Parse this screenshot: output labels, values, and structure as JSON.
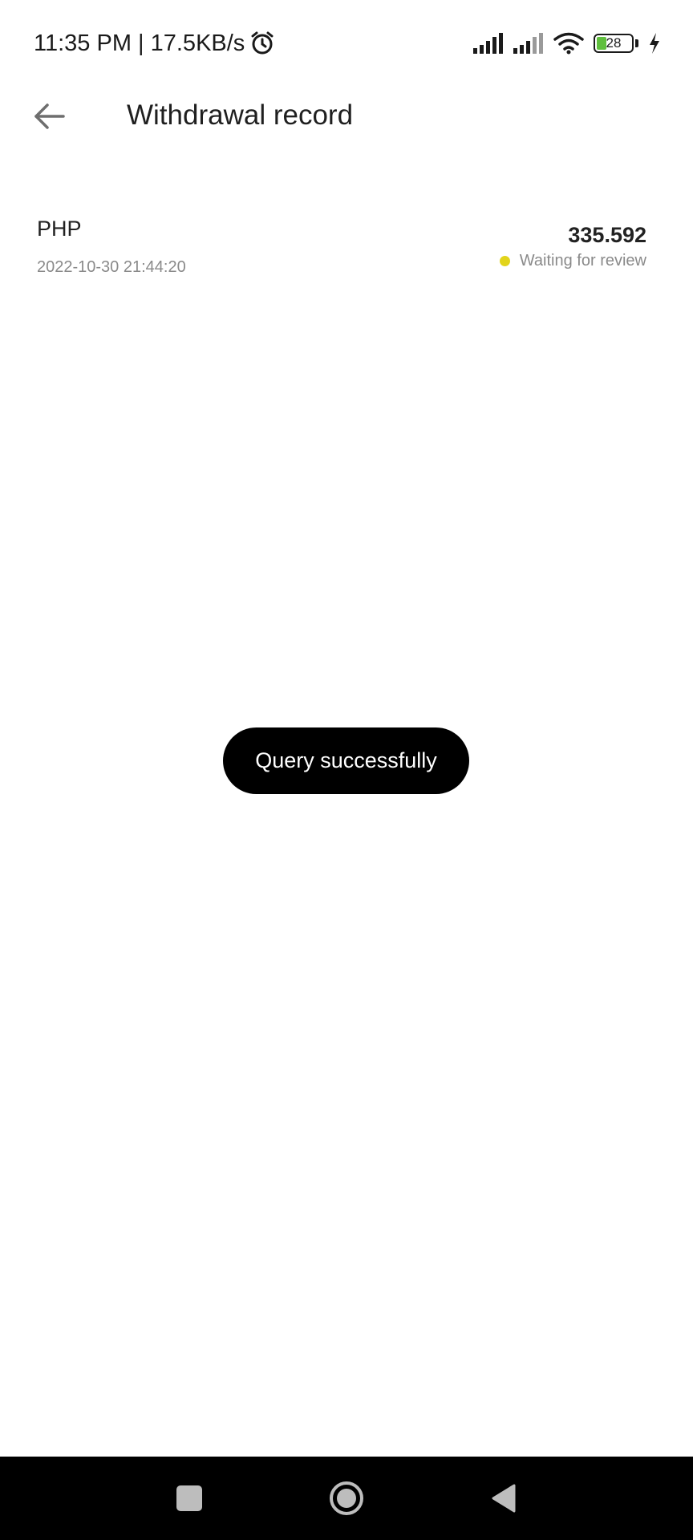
{
  "status_bar": {
    "time_speed": "11:35 PM | 17.5KB/s",
    "battery_level": "28",
    "icons": [
      "alarm-icon",
      "signal-icon",
      "signal-icon",
      "wifi-icon",
      "battery-icon",
      "charging-icon"
    ]
  },
  "header": {
    "title": "Withdrawal record",
    "back_icon": "arrow-left-icon"
  },
  "records": [
    {
      "currency": "PHP",
      "datetime": "2022-10-30 21:44:20",
      "amount": "335.592",
      "status": "Waiting for review",
      "status_color": "#e2d41b"
    }
  ],
  "toast": {
    "message": "Query successfully"
  },
  "nav_bar": {
    "buttons": [
      "recent-apps-icon",
      "home-icon",
      "back-triangle-icon"
    ]
  }
}
